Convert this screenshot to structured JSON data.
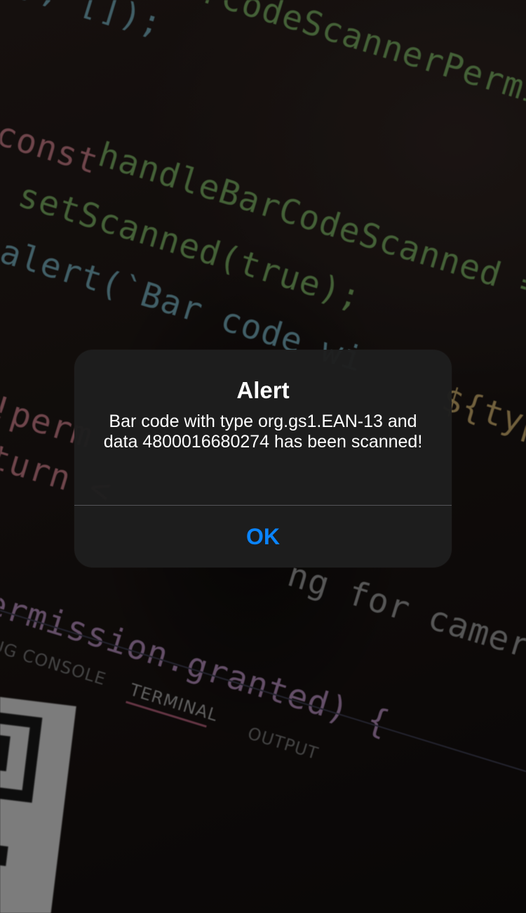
{
  "background_code": {
    "lines": [
      "}, []);",
      "BarCodeScannerPermiss",
      "const",
      "handleBarCodeScanned = (",
      "setScanned(true);",
      "alert(`Bar code wi",
      "${typ",
      "!perm",
      "turn <",
      "ng for camera p",
      "ermission.granted) {"
    ],
    "panel_tabs": [
      "UG CONSOLE",
      "TERMINAL",
      "OUTPUT"
    ],
    "active_tab": "TERMINAL"
  },
  "alert": {
    "title": "Alert",
    "message": "Bar code with type org.gs1.EAN-13 and data 4800016680274 has been scanned!",
    "ok_label": "OK"
  },
  "colors": {
    "alert_background": "#1e1e1e",
    "alert_button": "#0a84ff",
    "code_green": "#6f9d5a",
    "code_pink": "#b3707a"
  }
}
